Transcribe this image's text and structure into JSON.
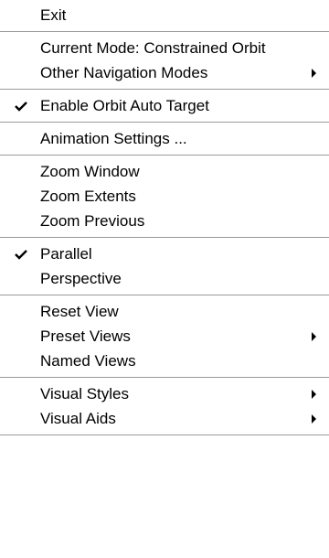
{
  "menu": {
    "exit": "Exit",
    "current_mode": "Current Mode: Constrained Orbit",
    "other_nav_modes": "Other Navigation Modes",
    "enable_orbit_autotarget": "Enable Orbit Auto Target",
    "animation_settings": "Animation Settings ...",
    "zoom_window": "Zoom Window",
    "zoom_extents": "Zoom Extents",
    "zoom_previous": "Zoom Previous",
    "parallel": "Parallel",
    "perspective": "Perspective",
    "reset_view": "Reset View",
    "preset_views": "Preset Views",
    "named_views": "Named Views",
    "visual_styles": "Visual Styles",
    "visual_aids": "Visual Aids"
  },
  "checked": {
    "enable_orbit_autotarget": true,
    "parallel": true
  },
  "icons": {
    "check": "checkmark-icon",
    "submenu": "submenu-arrow-icon"
  }
}
